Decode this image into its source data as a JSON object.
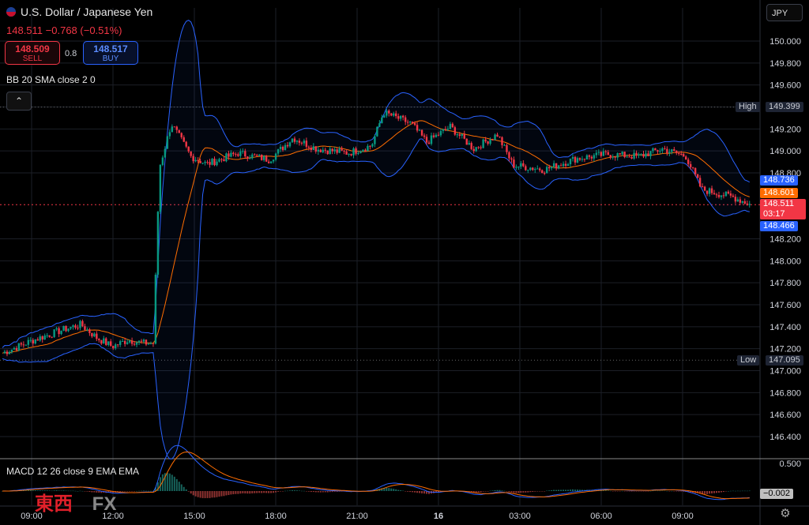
{
  "header": {
    "symbol_title": "U.S. Dollar / Japanese Yen",
    "last": "148.511",
    "change": "−0.768 (−0.51%)",
    "sell_price": "148.509",
    "sell_label": "SELL",
    "spread": "0.8",
    "buy_price": "148.517",
    "buy_label": "BUY",
    "currency_button": "JPY"
  },
  "indicators": {
    "bb_label": "BB 20 SMA close 2 0",
    "macd_label": "MACD 12 26 close 9 EMA EMA"
  },
  "price_axis": {
    "labels": [
      "150.000",
      "149.800",
      "149.600",
      "149.400",
      "149.200",
      "149.000",
      "148.800",
      "148.200",
      "148.000",
      "147.800",
      "147.600",
      "147.400",
      "147.200",
      "147.000",
      "146.800",
      "146.600",
      "146.400"
    ],
    "macd_top_label": "0.500",
    "macd_value": "−0.002"
  },
  "time_axis": {
    "labels": [
      "09:00",
      "12:00",
      "15:00",
      "18:00",
      "21:00",
      "16",
      "03:00",
      "06:00",
      "09:00"
    ]
  },
  "markers": {
    "high_label": "High",
    "high_value": "149.399",
    "low_label": "Low",
    "low_value": "147.095",
    "bb_upper": "148.736",
    "bb_basis": "148.601",
    "last_price": "148.511",
    "countdown": "03:17",
    "bb_lower": "148.466"
  },
  "colors": {
    "up": "#089981",
    "down": "#f23645",
    "bb_band": "#2962ff",
    "bb_basis": "#ff6d00",
    "macd": "#2962ff",
    "signal": "#ff6d00"
  },
  "watermark": {
    "logo_text": "FX"
  },
  "chart_data": {
    "type": "candlestick",
    "y_range": [
      146.3,
      150.1
    ],
    "sessions": [
      {
        "t": 0,
        "price": 147.16
      },
      {
        "t": 20,
        "price": 147.22
      },
      {
        "t": 40,
        "price": 147.28
      },
      {
        "t": 60,
        "price": 147.33
      },
      {
        "t": 80,
        "price": 147.38
      },
      {
        "t": 100,
        "price": 147.42
      },
      {
        "t": 120,
        "price": 147.3
      },
      {
        "t": 140,
        "price": 147.22
      },
      {
        "t": 160,
        "price": 147.28
      },
      {
        "t": 180,
        "price": 147.25
      },
      {
        "t": 192,
        "price": 147.25
      },
      {
        "t": 200,
        "price": 148.85
      },
      {
        "t": 215,
        "price": 149.25
      },
      {
        "t": 240,
        "price": 148.95
      },
      {
        "t": 260,
        "price": 148.88
      },
      {
        "t": 300,
        "price": 148.98
      },
      {
        "t": 340,
        "price": 148.92
      },
      {
        "t": 370,
        "price": 149.12
      },
      {
        "t": 400,
        "price": 149.02
      },
      {
        "t": 440,
        "price": 148.98
      },
      {
        "t": 470,
        "price": 149.05
      },
      {
        "t": 485,
        "price": 149.35
      },
      {
        "t": 520,
        "price": 149.25
      },
      {
        "t": 540,
        "price": 149.08
      },
      {
        "t": 570,
        "price": 149.22
      },
      {
        "t": 600,
        "price": 149.02
      },
      {
        "t": 630,
        "price": 149.15
      },
      {
        "t": 650,
        "price": 148.87
      },
      {
        "t": 690,
        "price": 148.83
      },
      {
        "t": 730,
        "price": 148.93
      },
      {
        "t": 770,
        "price": 148.97
      },
      {
        "t": 810,
        "price": 148.95
      },
      {
        "t": 840,
        "price": 149.02
      },
      {
        "t": 870,
        "price": 148.95
      },
      {
        "t": 890,
        "price": 148.65
      },
      {
        "t": 930,
        "price": 148.58
      },
      {
        "t": 953,
        "price": 148.51
      }
    ]
  }
}
